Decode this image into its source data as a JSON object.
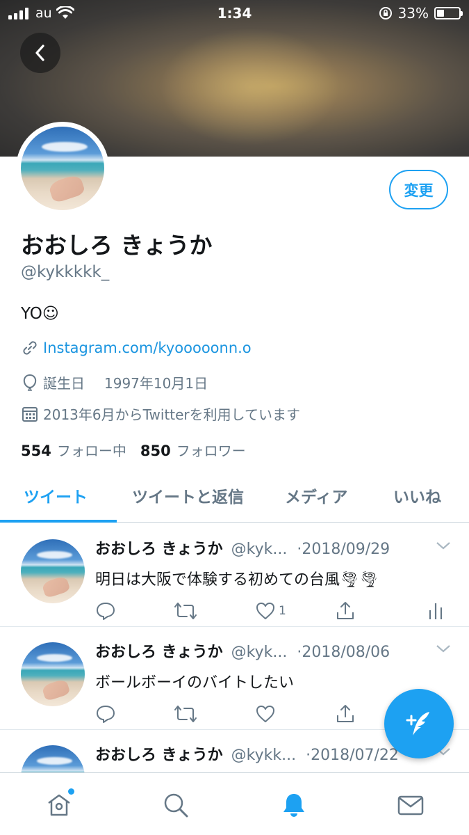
{
  "status_bar": {
    "carrier": "au",
    "time": "1:34",
    "battery_percent": "33%",
    "battery_level": 0.33
  },
  "profile": {
    "change_button": "変更",
    "display_name": "おおしろ きょうか",
    "handle": "@kykkkkk_",
    "bio": "YO☺",
    "link": "Instagram.com/kyooooonn.o",
    "birthday_label": "誕生日",
    "birthday_value": "1997年10月1日",
    "joined": "2013年6月からTwitterを利用しています",
    "following_count": "554",
    "following_label": "フォロー中",
    "followers_count": "850",
    "followers_label": "フォロワー"
  },
  "tabs": [
    {
      "label": "ツイート",
      "active": true
    },
    {
      "label": "ツイートと返信",
      "active": false
    },
    {
      "label": "メディア",
      "active": false
    },
    {
      "label": "いいね",
      "active": false
    }
  ],
  "tweets": [
    {
      "name": "おおしろ きょうか",
      "handle": "@kyk...",
      "date": "·2018/09/29",
      "text": "明日は大阪で体験する初めての台風🌪🌪",
      "likes": "1"
    },
    {
      "name": "おおしろ きょうか",
      "handle": "@kyk...",
      "date": "·2018/08/06",
      "text": "ボールボーイのバイトしたい",
      "likes": ""
    },
    {
      "name": "おおしろ きょうか",
      "handle": "@kykk...",
      "date": "·2018/07/22",
      "text": "",
      "likes": ""
    }
  ],
  "colors": {
    "accent": "#1da1f2",
    "secondary_text": "#657786"
  },
  "icons": [
    "back-arrow-icon",
    "link-icon",
    "balloon-icon",
    "calendar-icon",
    "reply-icon",
    "retweet-icon",
    "like-icon",
    "share-icon",
    "analytics-icon",
    "compose-icon",
    "home-icon",
    "search-icon",
    "notifications-icon",
    "messages-icon"
  ]
}
